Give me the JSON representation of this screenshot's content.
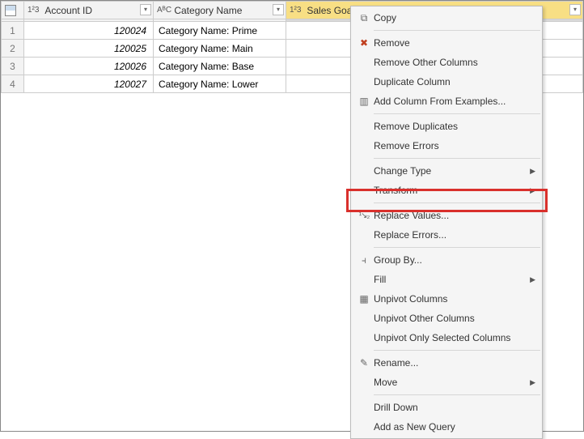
{
  "columns": {
    "rownum_icon": "▦",
    "account_id": {
      "type_label": "1²3",
      "label": "Account ID"
    },
    "category_name": {
      "type_label": "AᴮC",
      "label": "Category Name"
    },
    "sales_goal": {
      "type_label": "1²3",
      "label": "Sales Goal"
    }
  },
  "rows": [
    {
      "n": "1",
      "account_id": "120024",
      "category_name": "Category Name: Prime"
    },
    {
      "n": "2",
      "account_id": "120025",
      "category_name": "Category Name: Main"
    },
    {
      "n": "3",
      "account_id": "120026",
      "category_name": "Category Name: Base"
    },
    {
      "n": "4",
      "account_id": "120027",
      "category_name": "Category Name: Lower"
    }
  ],
  "menu": {
    "copy": "Copy",
    "remove": "Remove",
    "remove_other": "Remove Other Columns",
    "duplicate": "Duplicate Column",
    "add_from_examples": "Add Column From Examples...",
    "remove_duplicates": "Remove Duplicates",
    "remove_errors": "Remove Errors",
    "change_type": "Change Type",
    "transform": "Transform",
    "replace_values": "Replace Values...",
    "replace_errors": "Replace Errors...",
    "group_by": "Group By...",
    "fill": "Fill",
    "unpivot": "Unpivot Columns",
    "unpivot_other": "Unpivot Other Columns",
    "unpivot_selected": "Unpivot Only Selected Columns",
    "rename": "Rename...",
    "move": "Move",
    "drill_down": "Drill Down",
    "add_as_query": "Add as New Query"
  }
}
